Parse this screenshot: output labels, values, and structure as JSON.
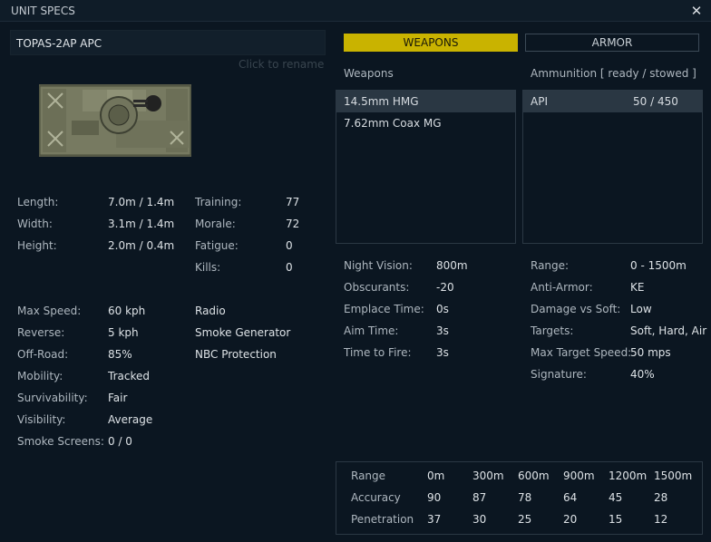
{
  "window": {
    "title": "UNIT SPECS",
    "close_label": "✕"
  },
  "unit": {
    "name": "TOPAS-2AP APC",
    "rename_hint": "Click to rename"
  },
  "stats_left": [
    {
      "label": "Length:",
      "value": "7.0m / 1.4m"
    },
    {
      "label": "Width:",
      "value": "3.1m / 1.4m"
    },
    {
      "label": "Height:",
      "value": "2.0m / 0.4m"
    }
  ],
  "stats_crew": [
    {
      "label": "Training:",
      "value": "77"
    },
    {
      "label": "Morale:",
      "value": "72"
    },
    {
      "label": "Fatigue:",
      "value": "0"
    },
    {
      "label": "Kills:",
      "value": "0"
    }
  ],
  "stats_mobility": [
    {
      "label": "Max Speed:",
      "value": "60 kph"
    },
    {
      "label": "Reverse:",
      "value": "5 kph"
    },
    {
      "label": "Off-Road:",
      "value": "85%"
    },
    {
      "label": "Mobility:",
      "value": "Tracked"
    },
    {
      "label": "Survivability:",
      "value": "Fair"
    },
    {
      "label": "Visibility:",
      "value": "Average"
    },
    {
      "label": "Smoke Screens:",
      "value": "0 / 0"
    }
  ],
  "equipment": [
    "Radio",
    "Smoke Generator",
    "NBC Protection"
  ],
  "tabs": {
    "weapons": "WEAPONS",
    "armor": "ARMOR"
  },
  "weapons_header": "Weapons",
  "ammo_header": "Ammunition [ ready / stowed ]",
  "weapons": [
    "14.5mm HMG",
    "7.62mm Coax MG"
  ],
  "ammunition": [
    {
      "name": "API",
      "count": "50 / 450"
    }
  ],
  "weapon_stats": [
    {
      "label": "Night Vision:",
      "value": "800m"
    },
    {
      "label": "Obscurants:",
      "value": "-20"
    },
    {
      "label": "Emplace Time:",
      "value": "0s"
    },
    {
      "label": "Aim Time:",
      "value": "3s"
    },
    {
      "label": "Time to Fire:",
      "value": "3s"
    }
  ],
  "ammo_stats": [
    {
      "label": "Range:",
      "value": "0 - 1500m"
    },
    {
      "label": "Anti-Armor:",
      "value": "KE"
    },
    {
      "label": "Damage vs Soft:",
      "value": "Low"
    },
    {
      "label": "Targets:",
      "value": "Soft, Hard, Air"
    },
    {
      "label": "Max Target Speed:",
      "value": "50 mps"
    },
    {
      "label": "Signature:",
      "value": "40%"
    }
  ],
  "range_table": {
    "rows": [
      {
        "label": "Range",
        "cells": [
          "0m",
          "300m",
          "600m",
          "900m",
          "1200m",
          "1500m"
        ]
      },
      {
        "label": "Accuracy",
        "cells": [
          "90",
          "87",
          "78",
          "64",
          "45",
          "28"
        ]
      },
      {
        "label": "Penetration",
        "cells": [
          "37",
          "30",
          "25",
          "20",
          "15",
          "12"
        ]
      }
    ]
  }
}
